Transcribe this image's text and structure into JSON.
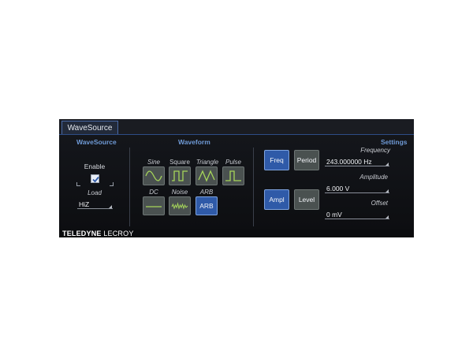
{
  "tab": {
    "label": "WaveSource"
  },
  "sections": {
    "wavesource": "WaveSource",
    "waveform": "Waveform",
    "settings": "Settings"
  },
  "wavesource": {
    "enable_label": "Enable",
    "enable_checked": true,
    "load_label": "Load",
    "load_value": "HiZ"
  },
  "waveforms": {
    "sine": "Sine",
    "square": "Square",
    "triangle": "Triangle",
    "pulse": "Pulse",
    "dc": "DC",
    "noise": "Noise",
    "arb": "ARB",
    "arb_button": "ARB",
    "selected": "ARB"
  },
  "settings": {
    "freq_button": "Freq",
    "period_button": "Period",
    "ampl_button": "Ampl",
    "level_button": "Level",
    "frequency_label": "Frequency",
    "frequency_value": "243.000000 Hz",
    "amplitude_label": "Amplitude",
    "amplitude_value": "6.000 V",
    "offset_label": "Offset",
    "offset_value": "0 mV"
  },
  "brand": {
    "bold": "TELEDYNE",
    "light": " LECROY"
  },
  "colors": {
    "accent": "#2f5aa8",
    "section_header": "#6f9ad6",
    "waveform_trace": "#a6d65a",
    "button_grey": "#4a5150"
  }
}
